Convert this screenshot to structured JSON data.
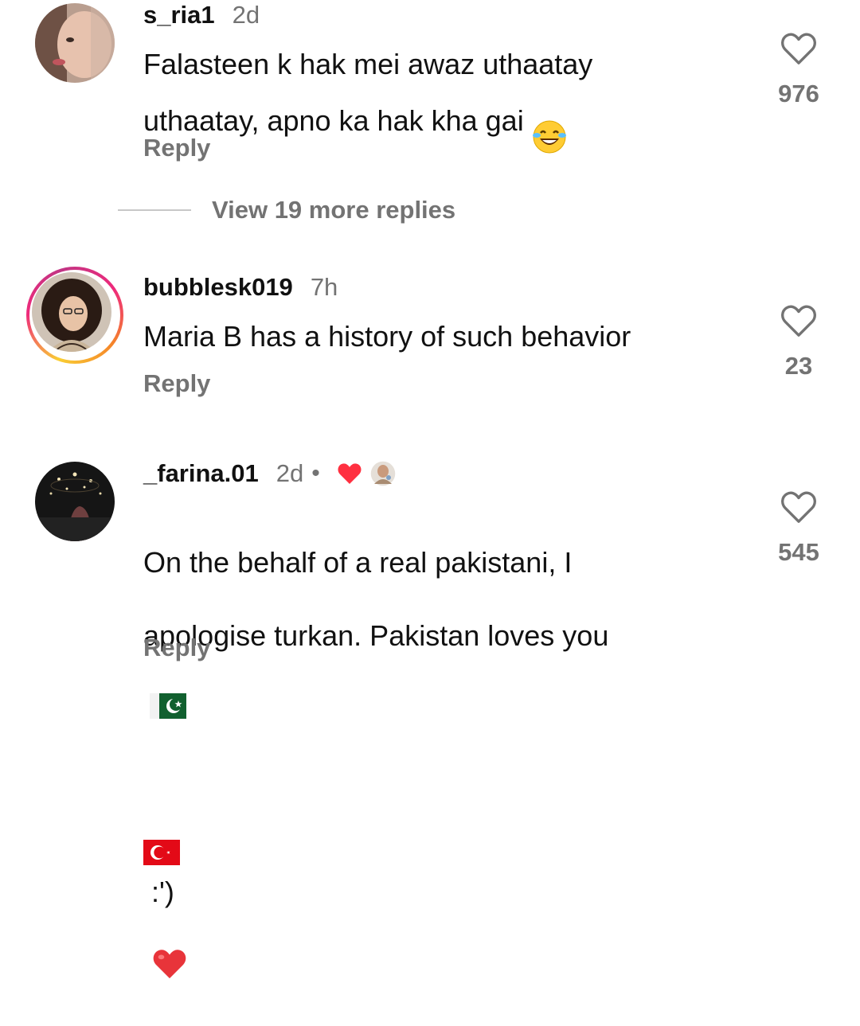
{
  "comments": [
    {
      "username": "s_ria1",
      "time": "2d",
      "text": "Falasteen k hak mei awaz uthaatay\nuthaatay, apno ka hak kha gai",
      "emoji": "laughing-tears",
      "reply_label": "Reply",
      "likes": "976"
    },
    {
      "username": "bubblesk019",
      "time": "7h",
      "text": "Maria B has a history of such behavior",
      "reply_label": "Reply",
      "likes": "23"
    },
    {
      "username": "_farina.01",
      "time": "2d",
      "separator": "•",
      "text_line1": "On the behalf of a real pakistani, I",
      "text_line2": "apologise turkan. Pakistan loves you",
      "text_line3": ":')",
      "reply_label": "Reply",
      "likes": "545"
    }
  ],
  "view_more": "View 19 more replies",
  "colors": {
    "secondary_text": "#737373",
    "heart_red": "#ff3040",
    "story_ring_start": "#f9ce34",
    "story_ring_end": "#ee2a7b"
  }
}
